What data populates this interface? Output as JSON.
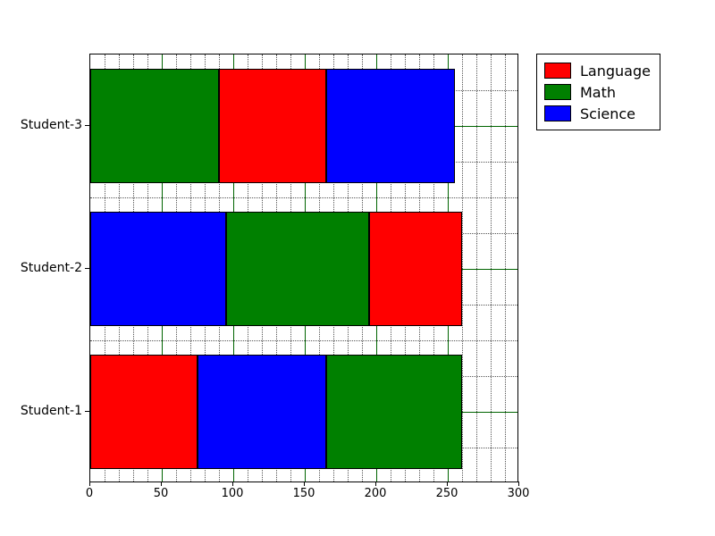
{
  "chart_data": {
    "type": "bar",
    "orientation": "horizontal-stacked",
    "categories": [
      "Student-1",
      "Student-2",
      "Student-3"
    ],
    "series": [
      {
        "name": "Language",
        "color": "#ff0000"
      },
      {
        "name": "Math",
        "color": "#008000"
      },
      {
        "name": "Science",
        "color": "#0000ff"
      }
    ],
    "segments": {
      "Student-1": [
        {
          "series": "Language",
          "value": 75
        },
        {
          "series": "Science",
          "value": 90
        },
        {
          "series": "Math",
          "value": 95
        }
      ],
      "Student-2": [
        {
          "series": "Science",
          "value": 95
        },
        {
          "series": "Math",
          "value": 100
        },
        {
          "series": "Language",
          "value": 65
        }
      ],
      "Student-3": [
        {
          "series": "Math",
          "value": 90
        },
        {
          "series": "Language",
          "value": 75
        },
        {
          "series": "Science",
          "value": 90
        }
      ]
    },
    "xlabel": "",
    "ylabel": "",
    "xlim": [
      0,
      300
    ],
    "x_ticks": [
      0,
      50,
      100,
      150,
      200,
      250,
      300
    ],
    "x_minor_step": 10,
    "grid": {
      "major_color": "#006400",
      "minor_style": "dotted"
    }
  },
  "xticks": {
    "t0": "0",
    "t1": "50",
    "t2": "100",
    "t3": "150",
    "t4": "200",
    "t5": "250",
    "t6": "300"
  },
  "yticks": {
    "s1": "Student-1",
    "s2": "Student-2",
    "s3": "Student-3"
  },
  "legend": {
    "l0": "Language",
    "l1": "Math",
    "l2": "Science"
  }
}
